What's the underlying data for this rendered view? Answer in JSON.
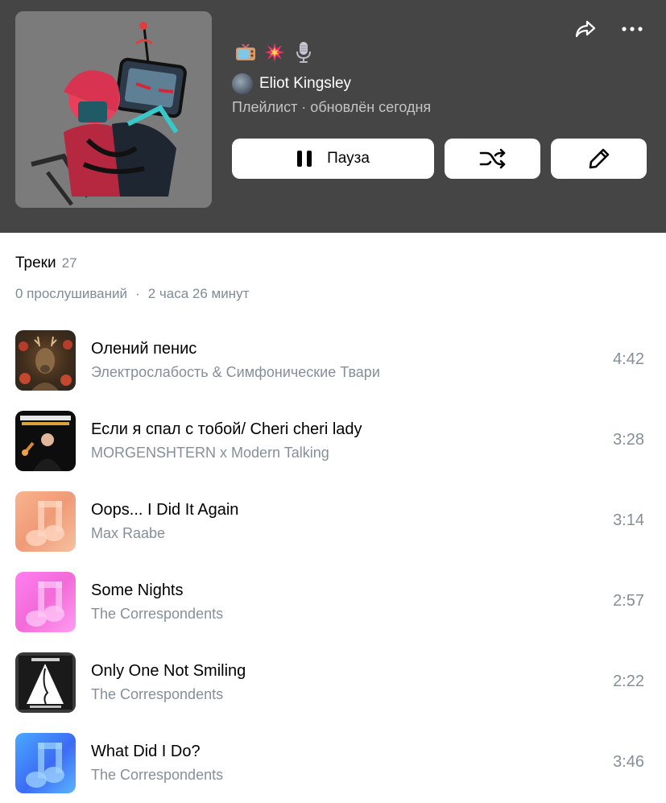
{
  "header": {
    "owner_name": "Eliot Kingsley",
    "subtitle": "Плейлист · обновлён сегодня",
    "emojis": [
      "tv-icon",
      "explosion-icon",
      "microphone-icon"
    ],
    "pause_label": "Пауза"
  },
  "tracks_section": {
    "title": "Треки",
    "count": "27",
    "plays": "0 прослушиваний",
    "separator": "·",
    "duration": "2 часа 26 минут"
  },
  "tracks": [
    {
      "title": "Олений пенис",
      "artist": "Электрослабость & Симфонические Твари",
      "duration": "4:42",
      "cover": "deer-cover"
    },
    {
      "title": "Если я спал с тобой/ Cheri cheri lady",
      "artist": "MORGENSHTERN x Modern Talking",
      "duration": "3:28",
      "cover": "dieter-cover"
    },
    {
      "title": "Oops... I Did It Again",
      "artist": "Max Raabe",
      "duration": "3:14",
      "cover": "peach-music-note-cover"
    },
    {
      "title": "Some Nights",
      "artist": "The Correspondents",
      "duration": "2:57",
      "cover": "pink-music-note-cover"
    },
    {
      "title": "Only One Not Smiling",
      "artist": "The Correspondents",
      "duration": "2:22",
      "cover": "triangle-cover"
    },
    {
      "title": "What Did I Do?",
      "artist": "The Correspondents",
      "duration": "3:46",
      "cover": "blue-music-note-cover"
    }
  ],
  "colors": {
    "header_bg": "#454545",
    "secondary_text": "#848f99",
    "button_bg": "#ffffff"
  }
}
